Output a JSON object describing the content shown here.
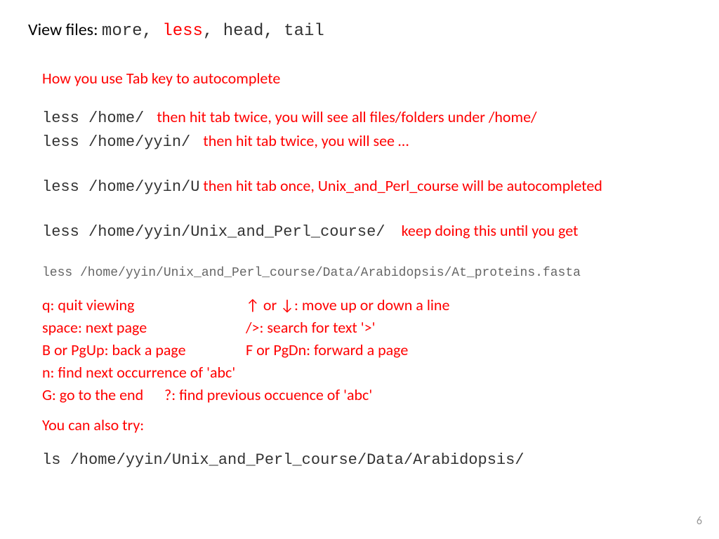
{
  "title": {
    "label": "View files: ",
    "cmd1": "more, ",
    "cmd_red": "less",
    "cmd2": ", head, tail"
  },
  "heading": "How you use Tab key to autocomplete",
  "line1": {
    "cmd": "less /home/ ",
    "note": " then hit tab twice, you will see all files/folders under /home/"
  },
  "line2": {
    "cmd": "less /home/yyin/ ",
    "note": " then hit tab twice, you will see …"
  },
  "line3": {
    "cmd": "less /home/yyin/U",
    "note": " then hit tab once, Unix_and_Perl_course will be autocompleted"
  },
  "line4": {
    "cmd": "less /home/yyin/Unix_and_Perl_course/ ",
    "note": "  keep doing this until you get"
  },
  "full_cmd": "less /home/yyin/Unix_and_Perl_course/Data/Arabidopsis/At_proteins.fasta",
  "shortcuts": {
    "r1c1": "q: quit viewing",
    "r1c2": "↑ or ↓: move up or down a line",
    "r2c1": "space: next page",
    "r2c2": "/>: search for text '>'",
    "r3c1": "B or PgUp: back a page",
    "r3c2": "F or PgDn: forward a page",
    "r4": "n: find next occurrence of 'abc'",
    "r5a": "G: go to the end",
    "r5b": "?: find previous occuence of 'abc'"
  },
  "also_try": "You can also try:",
  "ls_cmd": "ls /home/yyin/Unix_and_Perl_course/Data/Arabidopsis/",
  "page_num": "6"
}
